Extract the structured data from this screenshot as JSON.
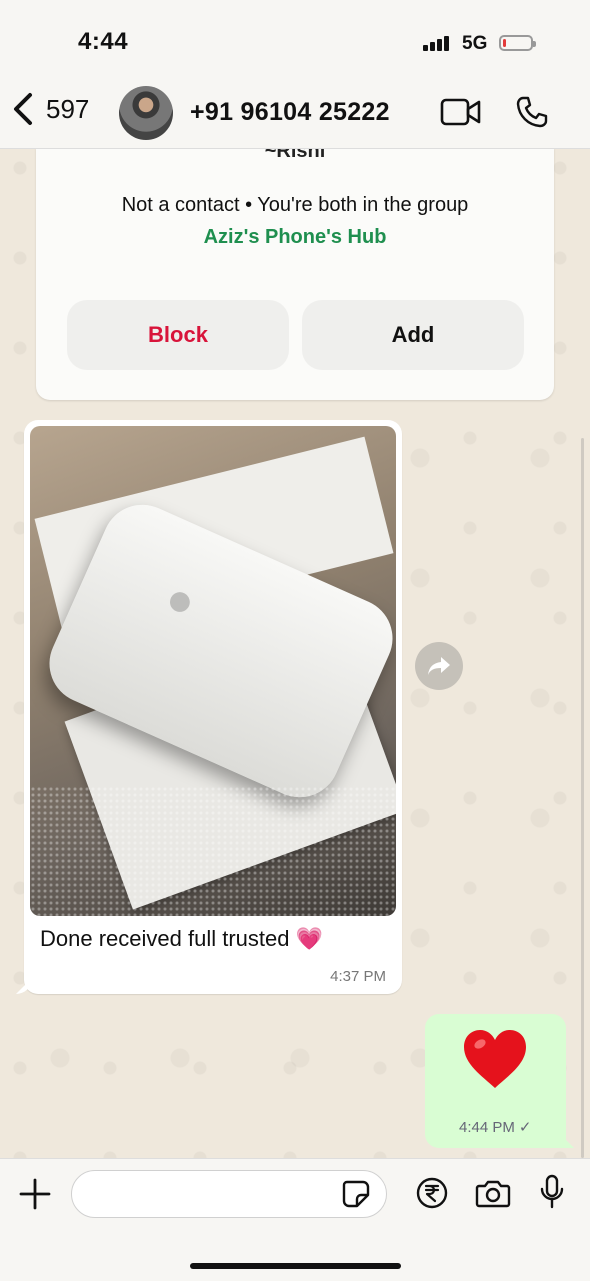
{
  "status_bar": {
    "time": "4:44",
    "network": "5G",
    "battery_level": 0.1
  },
  "header": {
    "back_count": "597",
    "contact_name": "+91 96104 25222"
  },
  "info_card": {
    "subtitle": "~Rishi",
    "relation": "Not a contact • You're both in the group",
    "group_name": "Aziz's Phone's Hub",
    "block_label": "Block",
    "add_label": "Add"
  },
  "messages": [
    {
      "direction": "incoming",
      "type": "image",
      "caption": "Done received  full trusted",
      "caption_emoji": "💗",
      "time": "4:37 PM"
    },
    {
      "direction": "outgoing",
      "type": "emoji",
      "emoji": "❤️",
      "time": "4:44 PM",
      "status": "✓"
    }
  ],
  "composer": {
    "placeholder": ""
  },
  "colors": {
    "block": "#d8143a",
    "group_link": "#1f8f4f",
    "outgoing_bubble": "#d9fdd3",
    "chat_bg": "#efe8dc"
  },
  "icons": [
    "chevron-left-icon",
    "video-camera-icon",
    "phone-icon",
    "plus-icon",
    "sticker-icon",
    "rupee-icon",
    "camera-icon",
    "microphone-icon",
    "forward-icon",
    "heart-icon"
  ]
}
